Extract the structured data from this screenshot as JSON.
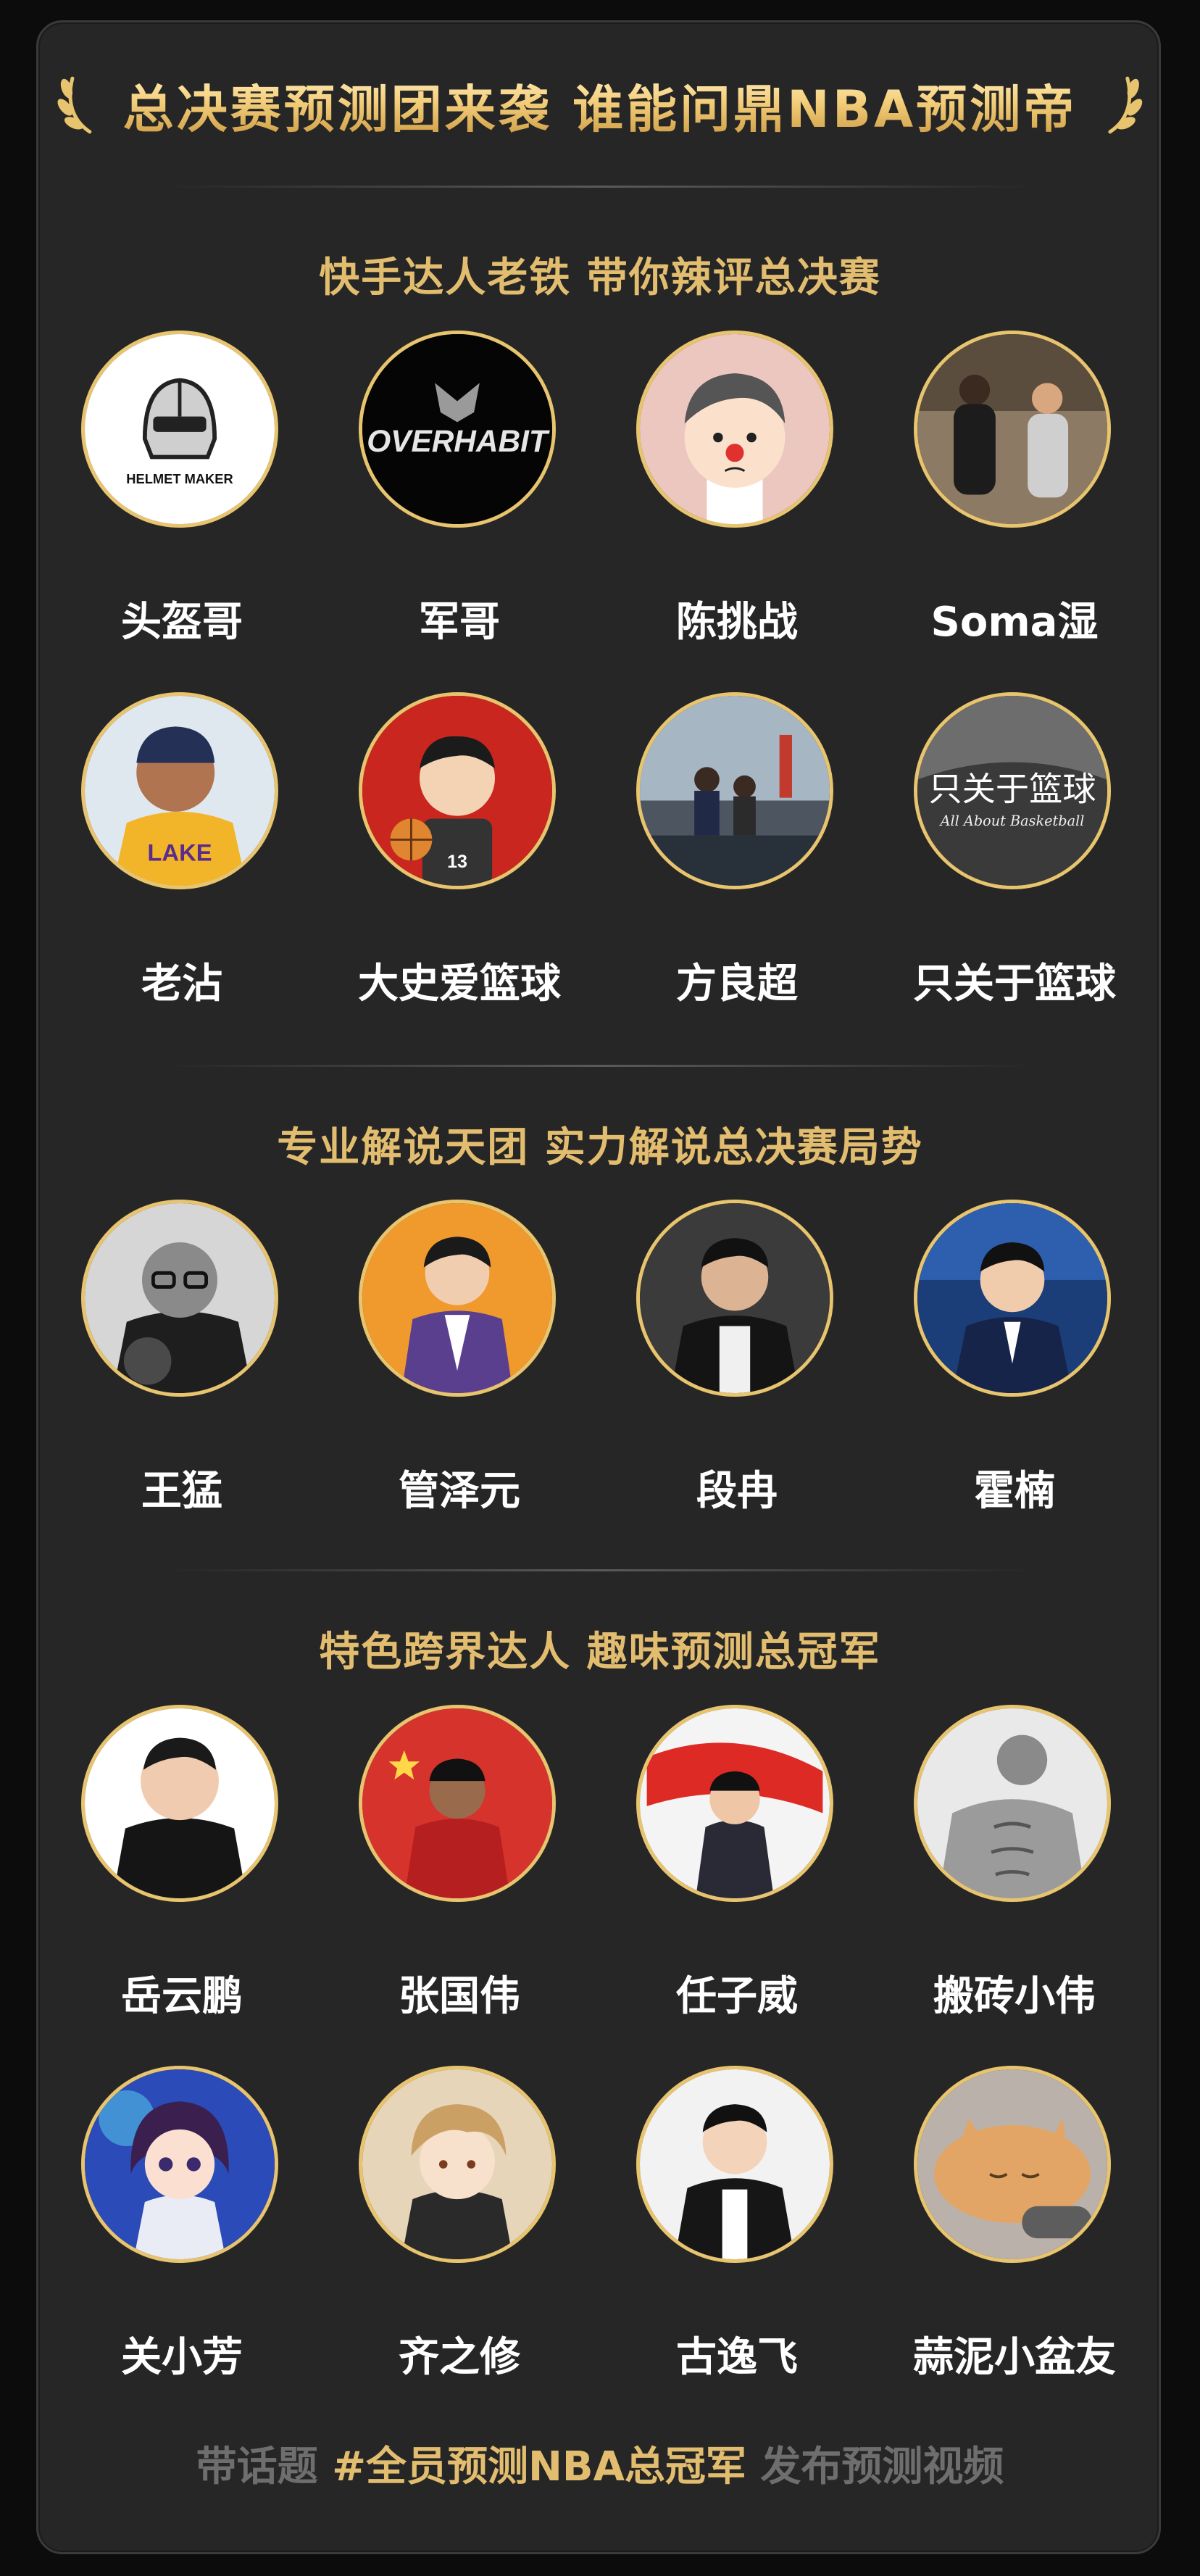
{
  "header": {
    "title": "总决赛预测团来袭 谁能问鼎NBA预测帝",
    "accent_color": "#e7c46d"
  },
  "sections": [
    {
      "title": "快手达人老铁 带你辣评总决赛",
      "people": [
        {
          "name": "头盔哥",
          "avatar": "helmet-maker-logo",
          "avatar_text": "HELMET MAKER"
        },
        {
          "name": "军哥",
          "avatar": "overhabit-logo",
          "avatar_text": "OVERHABIT"
        },
        {
          "name": "陈挑战",
          "avatar": "cartoon-boy-clown-nose"
        },
        {
          "name": "Soma湿",
          "avatar": "basketball-players-photo"
        },
        {
          "name": "老沾",
          "avatar": "man-in-lakers-jersey-photo"
        },
        {
          "name": "大史爱篮球",
          "avatar": "cartoon-man-holding-basketball"
        },
        {
          "name": "方良超",
          "avatar": "outdoor-basketball-crowd-photo"
        },
        {
          "name": "只关于篮球",
          "avatar": "all-about-basketball-logo",
          "avatar_text": "只关于篮球",
          "avatar_subtext": "All About Basketball"
        }
      ]
    },
    {
      "title": "专业解说天团 实力解说总决赛局势",
      "people": [
        {
          "name": "王猛",
          "avatar": "man-with-glasses-bw-photo"
        },
        {
          "name": "管泽元",
          "avatar": "man-in-purple-suit-photo"
        },
        {
          "name": "段冉",
          "avatar": "man-in-black-hoodie-photo"
        },
        {
          "name": "霍楠",
          "avatar": "commentator-in-studio-photo"
        }
      ]
    },
    {
      "title": "特色跨界达人 趣味预测总冠军",
      "people": [
        {
          "name": "岳云鹏",
          "avatar": "man-in-black-shirt-photo"
        },
        {
          "name": "张国伟",
          "avatar": "athlete-with-flag-photo"
        },
        {
          "name": "任子威",
          "avatar": "skater-with-flag-photo"
        },
        {
          "name": "搬砖小伟",
          "avatar": "muscular-man-sketch"
        },
        {
          "name": "关小芳",
          "avatar": "virtual-girl-3d"
        },
        {
          "name": "齐之修",
          "avatar": "anime-boy-illustration"
        },
        {
          "name": "古逸飞",
          "avatar": "man-in-black-coat-photo"
        },
        {
          "name": "蒜泥小盆友",
          "avatar": "sleeping-cat-with-controller-photo"
        }
      ]
    }
  ],
  "footer": {
    "prefix": "带话题",
    "hashtag": "#全员预测NBA总冠军",
    "suffix": "发布预测视频"
  }
}
